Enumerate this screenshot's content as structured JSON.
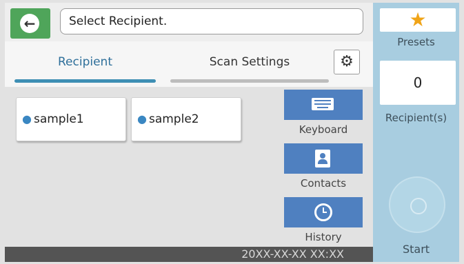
{
  "header": {
    "back_icon": "arrow-left-icon",
    "title": "Select Recipient."
  },
  "tabs": [
    {
      "label": "Recipient",
      "selected": true
    },
    {
      "label": "Scan Settings",
      "selected": false
    }
  ],
  "settings_icon": "gear-icon",
  "recipients": [
    {
      "label": "sample1",
      "icon": "person-icon"
    },
    {
      "label": "sample2",
      "icon": "person-icon"
    }
  ],
  "side_buttons": [
    {
      "label": "Keyboard",
      "icon": "keyboard-icon"
    },
    {
      "label": "Contacts",
      "icon": "contacts-icon"
    },
    {
      "label": "History",
      "icon": "history-icon"
    }
  ],
  "status": {
    "datetime": "20XX-XX-XX XX:XX"
  },
  "panel": {
    "presets_label": "Presets",
    "presets_icon": "star-icon",
    "recipient_count": "0",
    "recipient_count_label": "Recipient(s)",
    "start_label": "Start"
  },
  "colors": {
    "back_button": "#4fa55a",
    "accent_blue": "#4f80c0",
    "tab_underline_active": "#3e8fb4",
    "right_panel": "#a8cde0",
    "star": "#f0a418"
  }
}
